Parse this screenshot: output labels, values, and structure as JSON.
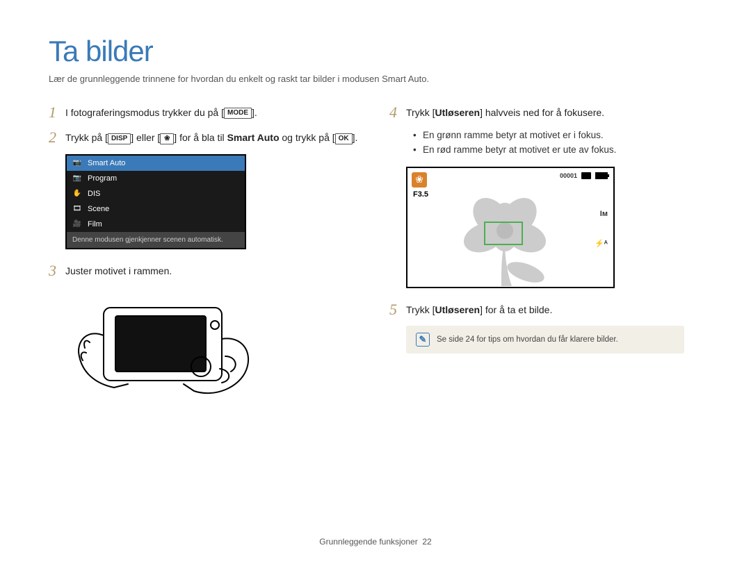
{
  "page": {
    "title": "Ta bilder",
    "subtitle": "Lær de grunnleggende trinnene for hvordan du enkelt og raskt tar bilder i modusen Smart Auto.",
    "footer_section": "Grunnleggende funksjoner",
    "footer_page": "22"
  },
  "steps": {
    "s1": {
      "num": "1",
      "pre": "I fotograferingsmodus trykker du på [",
      "btn": "MODE",
      "post": "]."
    },
    "s2": {
      "num": "2",
      "p1": "Trykk på [",
      "btn1": "DISP",
      "p2": "] eller [",
      "btn2": "❀",
      "p3": "] for å bla til ",
      "bold": "Smart Auto",
      "p4": " og trykk på [",
      "btn3": "OK",
      "p5": "]."
    },
    "s3": {
      "num": "3",
      "text": "Juster motivet i rammen."
    },
    "s4": {
      "num": "4",
      "pre": "Trykk [",
      "bold": "Utløseren",
      "post": "] halvveis ned for å fokusere.",
      "bullets": [
        "En grønn ramme betyr at motivet er i fokus.",
        "En rød ramme betyr at motivet er ute av fokus."
      ]
    },
    "s5": {
      "num": "5",
      "pre": "Trykk [",
      "bold": "Utløseren",
      "post": "] for å ta et bilde."
    }
  },
  "mode_menu": {
    "items": [
      {
        "glyph": "📷",
        "label": "Smart Auto",
        "selected": true
      },
      {
        "glyph": "📷",
        "label": "Program",
        "selected": false
      },
      {
        "glyph": "✋",
        "label": "DIS",
        "selected": false
      },
      {
        "glyph": "🎞",
        "label": "Scene",
        "selected": false
      },
      {
        "glyph": "🎥",
        "label": "Film",
        "selected": false
      }
    ],
    "description": "Denne modusen gjenkjenner scenen automatisk."
  },
  "focus_overlay": {
    "flower_glyph": "❀",
    "fstop": "F3.5",
    "counter": "00001",
    "res": "Iм",
    "flash": "⚡ᴬ"
  },
  "tip": {
    "icon": "✎",
    "text": "Se side 24 for tips om hvordan du får klarere bilder."
  }
}
